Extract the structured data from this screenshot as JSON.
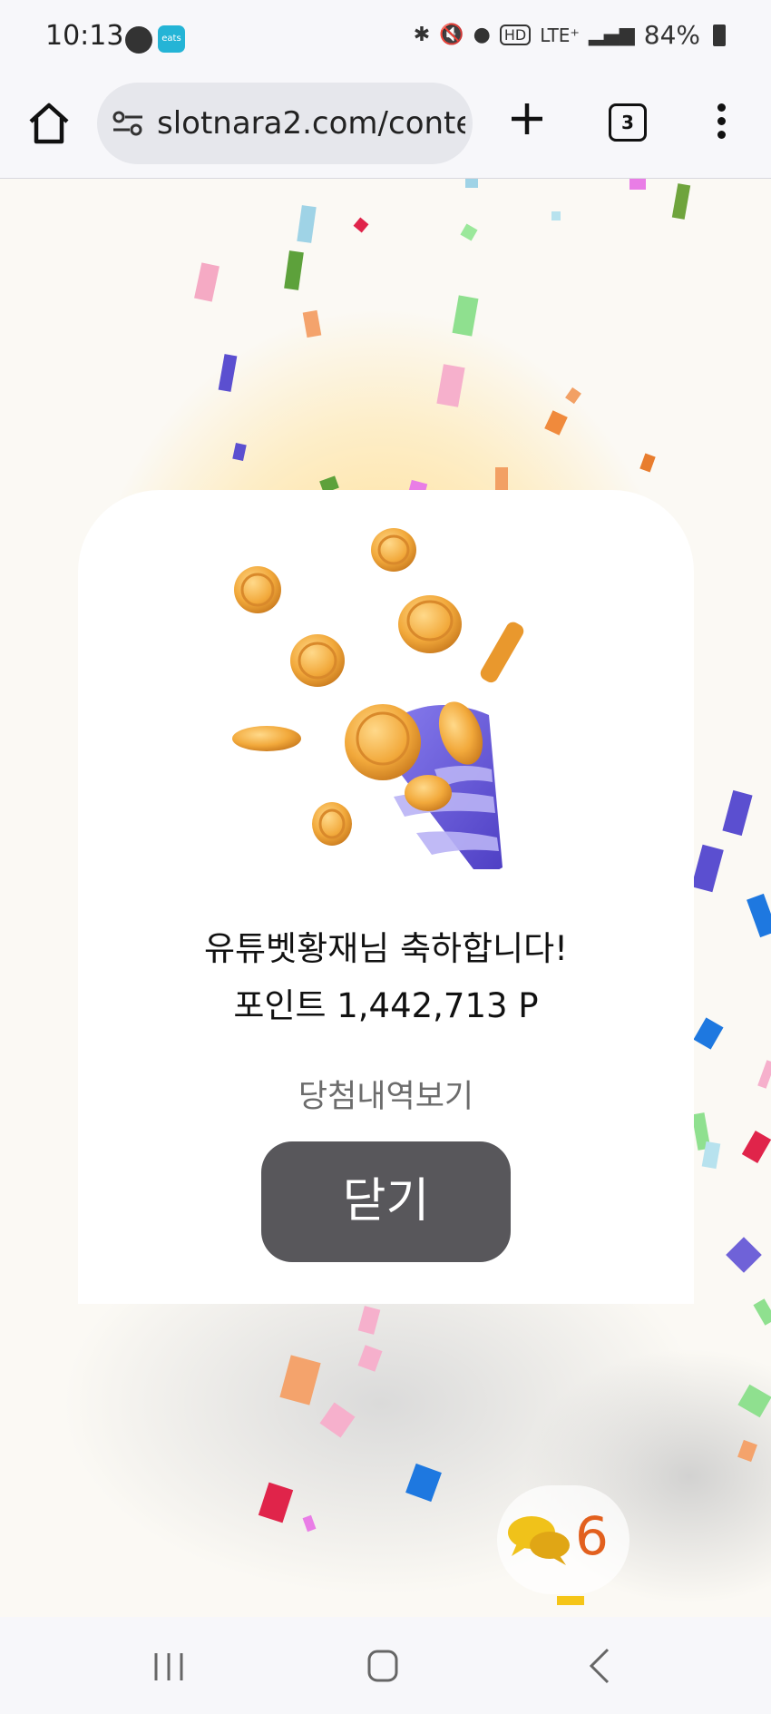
{
  "status_bar": {
    "time": "10:13",
    "app_badge": "eats",
    "network": "LTE⁺",
    "battery": "84%"
  },
  "browser": {
    "url": "slotnara2.com/conte",
    "tab_count": "3"
  },
  "modal": {
    "congrats_message": "유튜벳황재님 축하합니다!",
    "points_message": "포인트 1,442,713 P",
    "history_link": "당첨내역보기",
    "close_button": "닫기"
  },
  "chat": {
    "count": "6"
  },
  "colors": {
    "close_button_bg": "#58575b",
    "chat_count": "#e2601e",
    "cone_purple": "#6f62d8",
    "coin_gold": "#f2a93b"
  }
}
